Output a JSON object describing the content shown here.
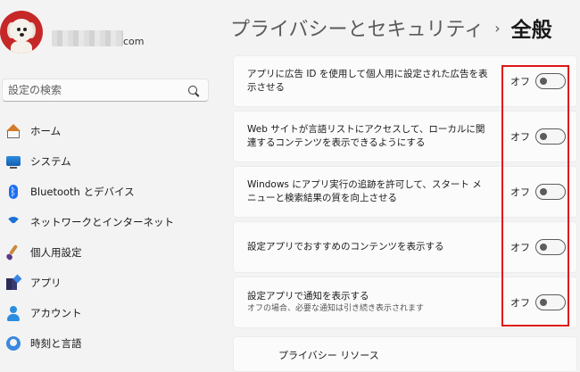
{
  "account": {
    "email_suffix": "com"
  },
  "search": {
    "placeholder": "設定の検索"
  },
  "nav": [
    {
      "label": "ホーム",
      "icon": "home-icon"
    },
    {
      "label": "システム",
      "icon": "monitor-icon"
    },
    {
      "label": "Bluetooth とデバイス",
      "icon": "bluetooth-icon"
    },
    {
      "label": "ネットワークとインターネット",
      "icon": "wifi-icon"
    },
    {
      "label": "個人用設定",
      "icon": "brush-icon"
    },
    {
      "label": "アプリ",
      "icon": "apps-icon"
    },
    {
      "label": "アカウント",
      "icon": "account-icon"
    },
    {
      "label": "時刻と言語",
      "icon": "clock-globe-icon"
    }
  ],
  "header": {
    "parent": "プライバシーとセキュリティ",
    "separator": "›",
    "current": "全般"
  },
  "settings": [
    {
      "text": "アプリに広告 ID を使用して個人用に設定された広告を表示させる",
      "subtext": "",
      "state": "オフ",
      "on": false
    },
    {
      "text": "Web サイトが言語リストにアクセスして、ローカルに関連するコンテンツを表示できるようにする",
      "subtext": "",
      "state": "オフ",
      "on": false
    },
    {
      "text": "Windows にアプリ実行の追跡を許可して、スタート メニューと検索結果の質を向上させる",
      "subtext": "",
      "state": "オフ",
      "on": false
    },
    {
      "text": "設定アプリでおすすめのコンテンツを表示する",
      "subtext": "",
      "state": "オフ",
      "on": false
    },
    {
      "text": "設定アプリで通知を表示する",
      "subtext": "オフの場合、必要な通知は引き続き表示されます",
      "state": "オフ",
      "on": false
    }
  ],
  "resources": {
    "label": "プライバシー リソース"
  },
  "colors": {
    "highlight": "#e01414",
    "accent": "#0067c0"
  }
}
